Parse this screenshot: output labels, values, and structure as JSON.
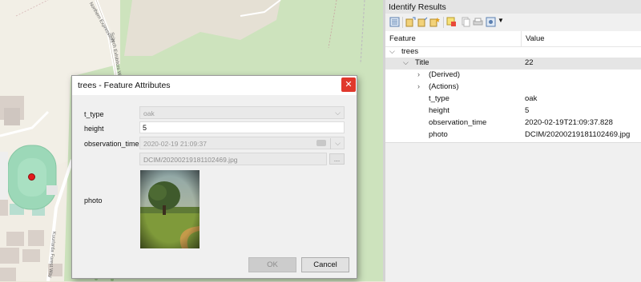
{
  "dialog": {
    "title": "trees - Feature Attributes",
    "close_glyph": "✕",
    "fields": {
      "t_type": {
        "label": "t_type",
        "value": "oak"
      },
      "height": {
        "label": "height",
        "value": "5"
      },
      "observation_time": {
        "label": "observation_time",
        "value": "2020-02-19 21:09:37"
      },
      "photo": {
        "label": "photo",
        "path": "DCIM/20200219181102469.jpg",
        "browse_label": "..."
      }
    },
    "ok_label": "OK",
    "cancel_label": "Cancel"
  },
  "identify": {
    "title": "Identify Results",
    "columns": {
      "feature": "Feature",
      "value": "Value"
    },
    "layer": "trees",
    "rows": [
      {
        "label": "Title",
        "value": "22"
      },
      {
        "label": "(Derived)",
        "value": ""
      },
      {
        "label": "(Actions)",
        "value": ""
      },
      {
        "label": "t_type",
        "value": "oak"
      },
      {
        "label": "height",
        "value": "5"
      },
      {
        "label": "observation_time",
        "value": "2020-02-19T21:09:37.828"
      },
      {
        "label": "photo",
        "value": "DCIM/20200219181102469.jpg"
      }
    ]
  },
  "map": {
    "street_labels": [
      "Northern Expressway",
      "Scitech Exhibitors Way",
      "Kuurlarda Forest Way"
    ],
    "marker_color": "#e41a1c"
  }
}
